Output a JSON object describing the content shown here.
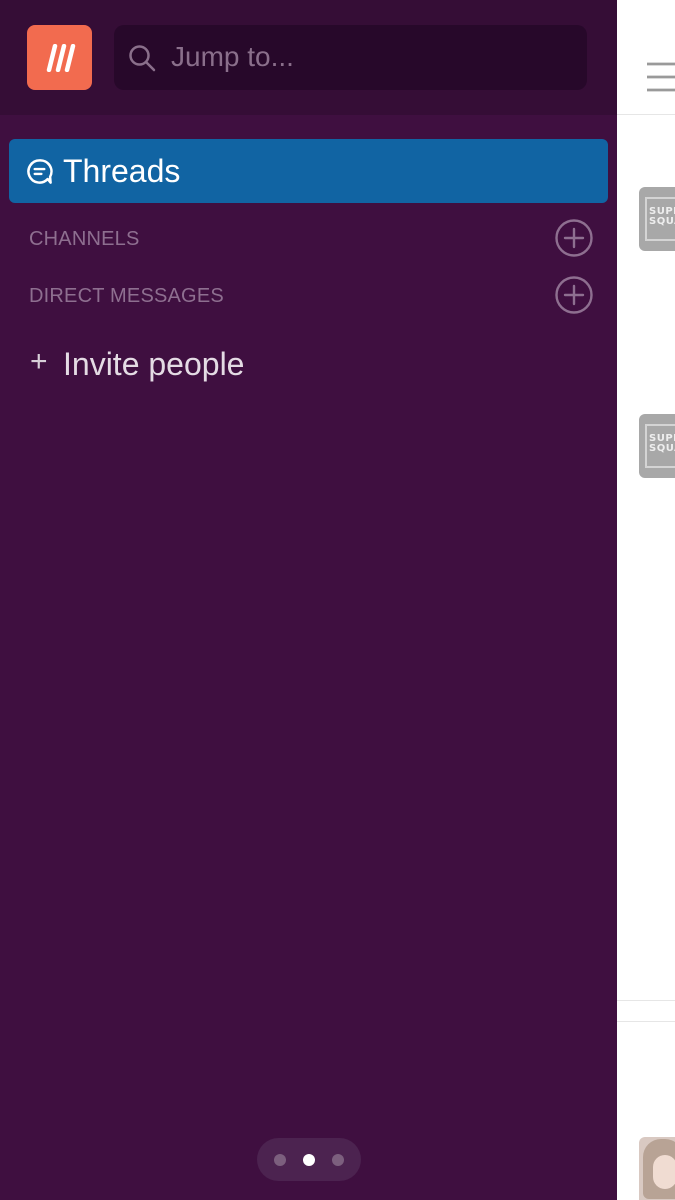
{
  "workspace": {
    "icon_glyph": "///",
    "icon_color": "#f26b4f"
  },
  "search": {
    "placeholder": "Jump to..."
  },
  "sidebar": {
    "background": "#3f0f40",
    "threads": {
      "label": "Threads",
      "icon": "threads-icon",
      "highlight_color": "#1164a3"
    },
    "sections": [
      {
        "title": "CHANNELS",
        "add_icon": "plus-circle-icon"
      },
      {
        "title": "DIRECT MESSAGES",
        "add_icon": "plus-circle-icon"
      }
    ],
    "invite": {
      "plus": "+",
      "label": "Invite people"
    }
  },
  "pager": {
    "count": 3,
    "active_index": 1
  },
  "peek": {
    "menu_icon": "hamburger-menu-icon",
    "avatar_text": [
      "SUPE",
      "SQUA"
    ]
  }
}
